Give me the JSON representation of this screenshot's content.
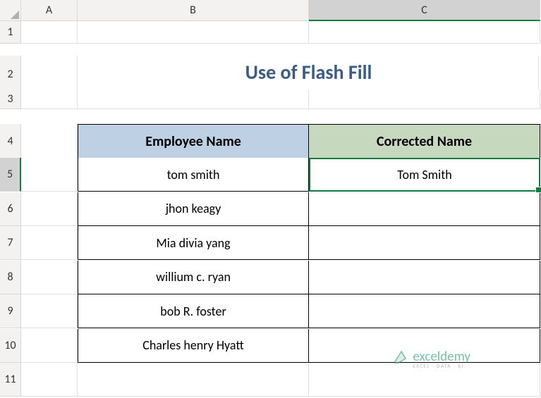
{
  "columns": [
    "A",
    "B",
    "C"
  ],
  "rows": [
    "1",
    "2",
    "3",
    "4",
    "5",
    "6",
    "7",
    "8",
    "9",
    "10",
    "11"
  ],
  "title": "Use of Flash Fill",
  "headers": {
    "employee": "Employee Name",
    "corrected": "Corrected Name"
  },
  "data": [
    {
      "employee": "tom smith",
      "corrected": "Tom Smith"
    },
    {
      "employee": "jhon keagy",
      "corrected": ""
    },
    {
      "employee": "Mia divia yang",
      "corrected": ""
    },
    {
      "employee": "willium c. ryan",
      "corrected": ""
    },
    {
      "employee": "bob R. foster",
      "corrected": ""
    },
    {
      "employee": "Charles henry Hyatt",
      "corrected": ""
    }
  ],
  "activeColumn": "C",
  "activeRow": "5",
  "watermark": {
    "name": "exceldemy",
    "tagline": "EXCEL · DATA · BI"
  }
}
